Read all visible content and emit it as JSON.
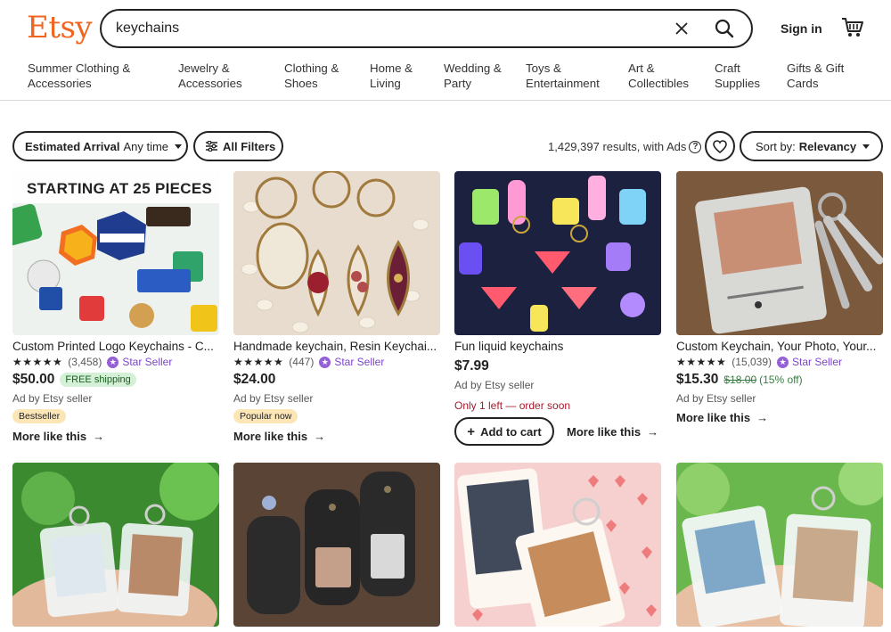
{
  "header": {
    "logo": "Etsy",
    "search_value": "keychains",
    "signin": "Sign in"
  },
  "categories": [
    "Summer Clothing &\nAccessories",
    "Jewelry &\nAccessories",
    "Clothing &\nShoes",
    "Home &\nLiving",
    "Wedding &\nParty",
    "Toys &\nEntertainment",
    "Art &\nCollectibles",
    "Craft\nSupplies",
    "Gifts & Gift\nCards"
  ],
  "filters": {
    "arrival_label": "Estimated Arrival",
    "arrival_value": "Any time",
    "all_filters": "All Filters",
    "results": "1,429,397 results, with Ads",
    "sort_label": "Sort by:",
    "sort_value": "Relevancy"
  },
  "products": [
    {
      "title": "Custom Printed Logo Keychains - C...",
      "reviews": "(3,458)",
      "star_seller": "Star Seller",
      "price": "$50.00",
      "free_shipping": "FREE shipping",
      "ad": "Ad by Etsy seller",
      "badge": "Bestseller",
      "more": "More like this",
      "image_text": "STARTING AT 25 PIECES"
    },
    {
      "title": "Handmade keychain, Resin Keychai...",
      "reviews": "(447)",
      "star_seller": "Star Seller",
      "price": "$24.00",
      "ad": "Ad by Etsy seller",
      "badge": "Popular now",
      "more": "More like this"
    },
    {
      "title": "Fun liquid keychains",
      "price": "$7.99",
      "ad": "Ad by Etsy seller",
      "stock": "Only 1 left — order soon",
      "add_to_cart": "Add to cart",
      "more": "More like this"
    },
    {
      "title": "Custom Keychain, Your Photo, Your...",
      "reviews": "(15,039)",
      "star_seller": "Star Seller",
      "price": "$15.30",
      "original_price": "$18.00",
      "discount": "(15% off)",
      "ad": "Ad by Etsy seller",
      "more": "More like this"
    }
  ],
  "colors": {
    "brand": "#F1641E",
    "star_seller": "#7b45c9",
    "free_shipping_bg": "#d4f0d6",
    "badge_bg": "#fde6b6",
    "stock_warning": "#a61a2e"
  }
}
